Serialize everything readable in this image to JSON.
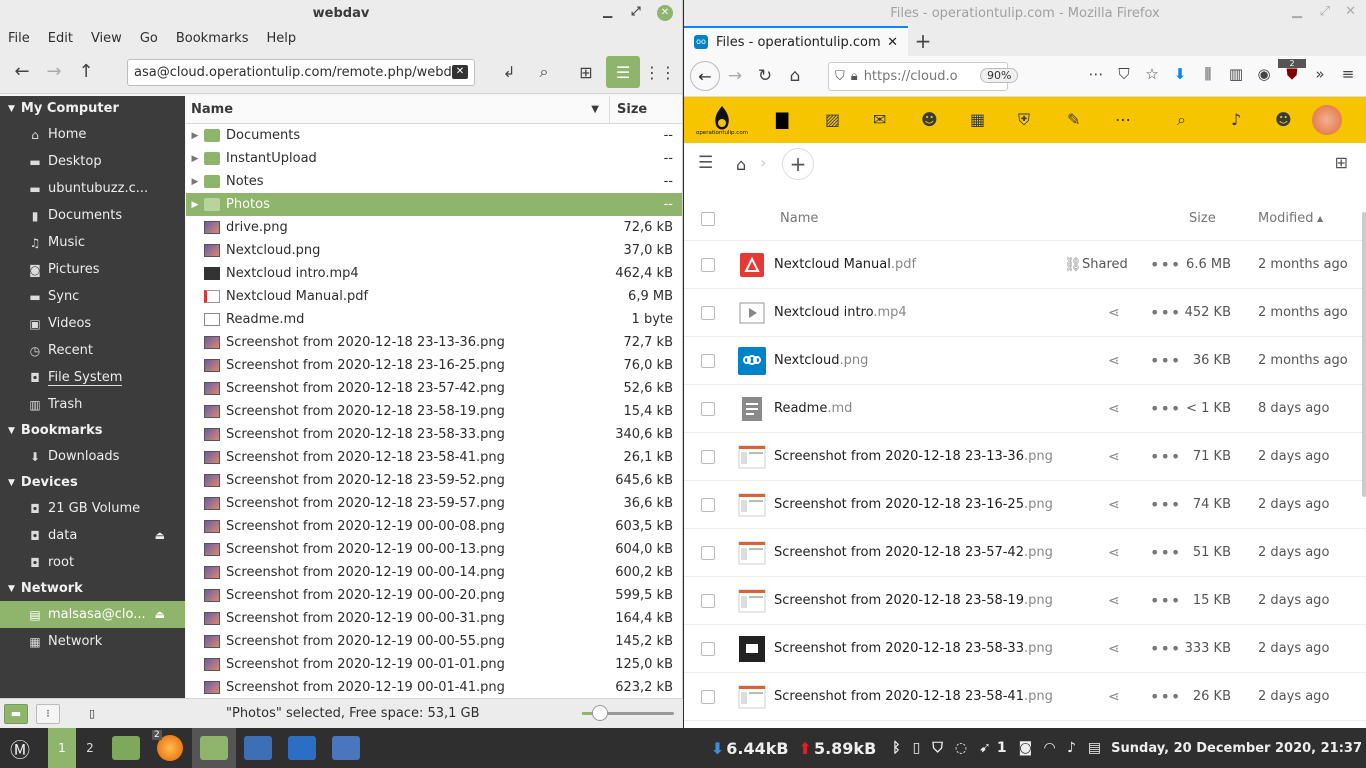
{
  "nemo": {
    "title": "webdav",
    "menu": [
      "File",
      "Edit",
      "View",
      "Go",
      "Bookmarks",
      "Help"
    ],
    "location": "asa@cloud.operationtulip.com/remote.php/webdav",
    "sidebar": {
      "my_computer": {
        "header": "My Computer",
        "items": [
          {
            "label": "Home",
            "icon": "home-icon"
          },
          {
            "label": "Desktop",
            "icon": "folder-icon"
          },
          {
            "label": "ubuntubuzz.c...",
            "icon": "folder-icon"
          },
          {
            "label": "Documents",
            "icon": "document-icon"
          },
          {
            "label": "Music",
            "icon": "music-icon"
          },
          {
            "label": "Pictures",
            "icon": "camera-icon"
          },
          {
            "label": "Sync",
            "icon": "folder-icon"
          },
          {
            "label": "Videos",
            "icon": "video-icon"
          },
          {
            "label": "Recent",
            "icon": "clock-icon"
          },
          {
            "label": "File System",
            "icon": "drive-icon"
          },
          {
            "label": "Trash",
            "icon": "trash-icon"
          }
        ]
      },
      "bookmarks": {
        "header": "Bookmarks",
        "items": [
          {
            "label": "Downloads",
            "icon": "download-icon"
          }
        ]
      },
      "devices": {
        "header": "Devices",
        "items": [
          {
            "label": "21 GB Volume",
            "icon": "drive-icon"
          },
          {
            "label": "data",
            "icon": "drive-icon"
          },
          {
            "label": "root",
            "icon": "drive-icon"
          }
        ]
      },
      "network": {
        "header": "Network",
        "items": [
          {
            "label": "malsasa@clo...",
            "icon": "server-icon"
          },
          {
            "label": "Network",
            "icon": "network-icon"
          }
        ]
      }
    },
    "columns": {
      "name": "Name",
      "size": "Size"
    },
    "files": [
      {
        "name": "Documents",
        "size": "--",
        "type": "folder"
      },
      {
        "name": "InstantUpload",
        "size": "--",
        "type": "folder"
      },
      {
        "name": "Notes",
        "size": "--",
        "type": "folder"
      },
      {
        "name": "Photos",
        "size": "--",
        "type": "folder"
      },
      {
        "name": "drive.png",
        "size": "72,6 kB",
        "type": "img"
      },
      {
        "name": "Nextcloud.png",
        "size": "37,0 kB",
        "type": "img"
      },
      {
        "name": "Nextcloud intro.mp4",
        "size": "462,4 kB",
        "type": "vid"
      },
      {
        "name": "Nextcloud Manual.pdf",
        "size": "6,9 MB",
        "type": "pdf"
      },
      {
        "name": "Readme.md",
        "size": "1 byte",
        "type": "md"
      },
      {
        "name": "Screenshot from 2020-12-18 23-13-36.png",
        "size": "72,7 kB",
        "type": "img"
      },
      {
        "name": "Screenshot from 2020-12-18 23-16-25.png",
        "size": "76,0 kB",
        "type": "img"
      },
      {
        "name": "Screenshot from 2020-12-18 23-57-42.png",
        "size": "52,6 kB",
        "type": "img"
      },
      {
        "name": "Screenshot from 2020-12-18 23-58-19.png",
        "size": "15,4 kB",
        "type": "img"
      },
      {
        "name": "Screenshot from 2020-12-18 23-58-33.png",
        "size": "340,6 kB",
        "type": "img"
      },
      {
        "name": "Screenshot from 2020-12-18 23-58-41.png",
        "size": "26,1 kB",
        "type": "img"
      },
      {
        "name": "Screenshot from 2020-12-18 23-59-52.png",
        "size": "645,6 kB",
        "type": "img"
      },
      {
        "name": "Screenshot from 2020-12-18 23-59-57.png",
        "size": "36,6 kB",
        "type": "img"
      },
      {
        "name": "Screenshot from 2020-12-19 00-00-08.png",
        "size": "603,5 kB",
        "type": "img"
      },
      {
        "name": "Screenshot from 2020-12-19 00-00-13.png",
        "size": "604,0 kB",
        "type": "img"
      },
      {
        "name": "Screenshot from 2020-12-19 00-00-14.png",
        "size": "600,2 kB",
        "type": "img"
      },
      {
        "name": "Screenshot from 2020-12-19 00-00-20.png",
        "size": "599,5 kB",
        "type": "img"
      },
      {
        "name": "Screenshot from 2020-12-19 00-00-31.png",
        "size": "164,4 kB",
        "type": "img"
      },
      {
        "name": "Screenshot from 2020-12-19 00-00-55.png",
        "size": "145,2 kB",
        "type": "img"
      },
      {
        "name": "Screenshot from 2020-12-19 00-01-01.png",
        "size": "125,0 kB",
        "type": "img"
      },
      {
        "name": "Screenshot from 2020-12-19 00-01-41.png",
        "size": "623,2 kB",
        "type": "img"
      }
    ],
    "selected_file": "Photos",
    "status": "\"Photos\" selected, Free space: 53,1 GB",
    "zoom_level": 0.2
  },
  "firefox": {
    "window_title": "Files - operationtulip.com - Mozilla Firefox",
    "tab_title": "Files - operationtulip.com",
    "url": "https://cloud.o",
    "zoom": "90%",
    "badge_count": "2",
    "nextcloud": {
      "logo_text": "operationtulip.com",
      "columns": {
        "name": "Name",
        "size": "Size",
        "modified": "Modified"
      },
      "files": [
        {
          "base": "Nextcloud Manual",
          "ext": ".pdf",
          "size": "6.6 MB",
          "modified": "2 months ago",
          "shared": "Shared",
          "thumb": "pdf"
        },
        {
          "base": "Nextcloud intro",
          "ext": ".mp4",
          "size": "452 KB",
          "modified": "2 months ago",
          "shared": "",
          "thumb": "video"
        },
        {
          "base": "Nextcloud",
          "ext": ".png",
          "size": "36 KB",
          "modified": "2 months ago",
          "shared": "",
          "thumb": "nc"
        },
        {
          "base": "Readme",
          "ext": ".md",
          "size": "< 1 KB",
          "modified": "8 days ago",
          "shared": "",
          "thumb": "doc"
        },
        {
          "base": "Screenshot from 2020-12-18 23-13-36",
          "ext": ".png",
          "size": "71 KB",
          "modified": "2 days ago",
          "shared": "",
          "thumb": "shot"
        },
        {
          "base": "Screenshot from 2020-12-18 23-16-25",
          "ext": ".png",
          "size": "74 KB",
          "modified": "2 days ago",
          "shared": "",
          "thumb": "shot"
        },
        {
          "base": "Screenshot from 2020-12-18 23-57-42",
          "ext": ".png",
          "size": "51 KB",
          "modified": "2 days ago",
          "shared": "",
          "thumb": "shot"
        },
        {
          "base": "Screenshot from 2020-12-18 23-58-19",
          "ext": ".png",
          "size": "15 KB",
          "modified": "2 days ago",
          "shared": "",
          "thumb": "shot"
        },
        {
          "base": "Screenshot from 2020-12-18 23-58-33",
          "ext": ".png",
          "size": "333 KB",
          "modified": "2 days ago",
          "shared": "",
          "thumb": "dark"
        },
        {
          "base": "Screenshot from 2020-12-18 23-58-41",
          "ext": ".png",
          "size": "26 KB",
          "modified": "2 days ago",
          "shared": "",
          "thumb": "shot"
        }
      ]
    }
  },
  "taskbar": {
    "workspaces": [
      "1",
      "2"
    ],
    "firefox_badge": "2",
    "net_down": "6.44kB",
    "net_up": "5.89kB",
    "tray_count": "1",
    "clock": "Sunday, 20 December 2020, 21:37"
  },
  "colors": {
    "accent": "#8fb46c",
    "nextcloud_header": "#f7c500",
    "firefox_tab": "#0a84ff"
  }
}
